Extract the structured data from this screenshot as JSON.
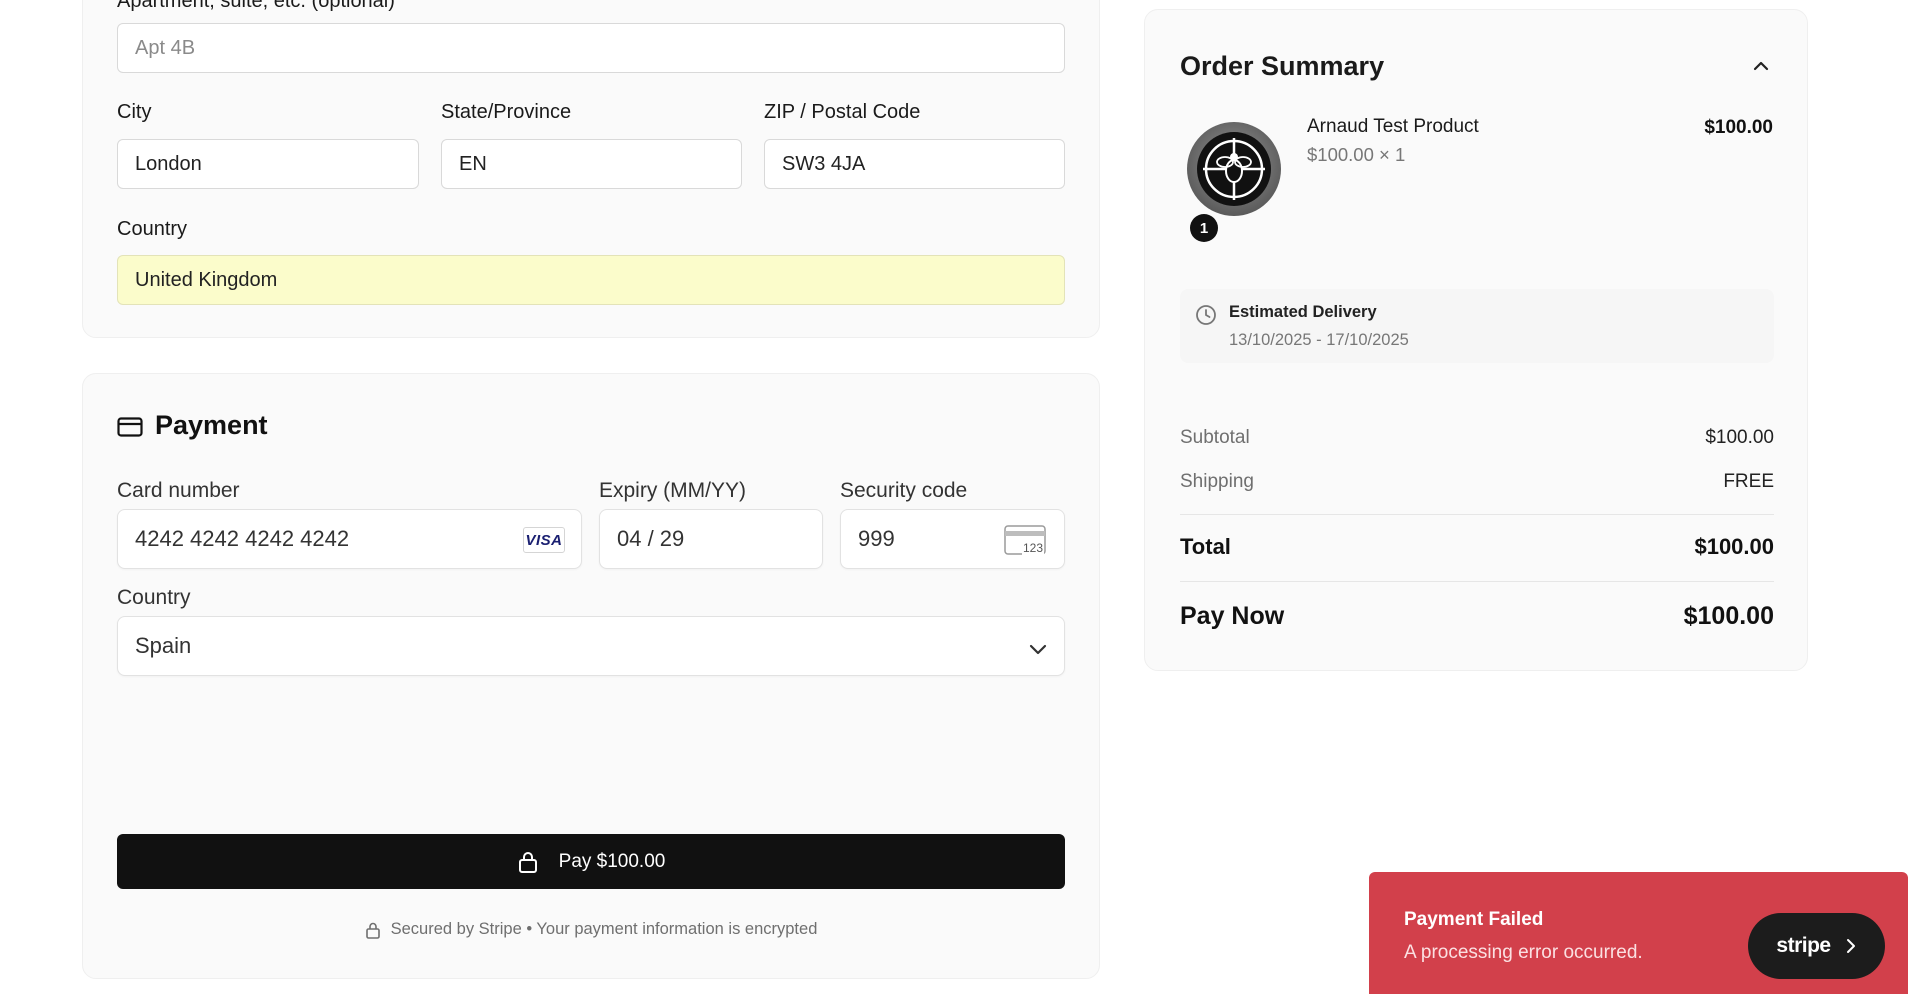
{
  "address": {
    "apartment_label": "Apartment, suite, etc. (optional)",
    "apartment_value": "Apt 4B",
    "city_label": "City",
    "city_value": "London",
    "state_label": "State/Province",
    "state_value": "EN",
    "zip_label": "ZIP / Postal Code",
    "zip_value": "SW3 4JA",
    "country_label": "Country",
    "country_value": "United Kingdom"
  },
  "payment": {
    "title": "Payment",
    "card_number_label": "Card number",
    "card_number_value": "4242 4242 4242 4242",
    "card_brand": "VISA",
    "expiry_label": "Expiry (MM/YY)",
    "expiry_value": "04 / 29",
    "cvc_label": "Security code",
    "cvc_value": "999",
    "cvc_icon_text": "123",
    "country_label": "Country",
    "country_value": "Spain",
    "pay_button_label": "Pay $100.00",
    "secure_note": "Secured by Stripe • Your payment information is encrypted"
  },
  "summary": {
    "title": "Order Summary",
    "product_name": "Arnaud Test Product",
    "product_detail": "$100.00 × 1",
    "product_price": "$100.00",
    "quantity_badge": "1",
    "delivery_label": "Estimated Delivery",
    "delivery_dates": "13/10/2025 - 17/10/2025",
    "subtotal_label": "Subtotal",
    "subtotal_value": "$100.00",
    "shipping_label": "Shipping",
    "shipping_value": "FREE",
    "total_label": "Total",
    "total_value": "$100.00",
    "pay_now_label": "Pay Now",
    "pay_now_value": "$100.00"
  },
  "toast": {
    "title": "Payment Failed",
    "message": "A processing error occurred.",
    "badge_label": "stripe"
  },
  "colors": {
    "autofill": "#fbfccb",
    "pay_button": "#111111",
    "toast": "#d2404b",
    "stripe_badge": "#1c1c1c"
  }
}
